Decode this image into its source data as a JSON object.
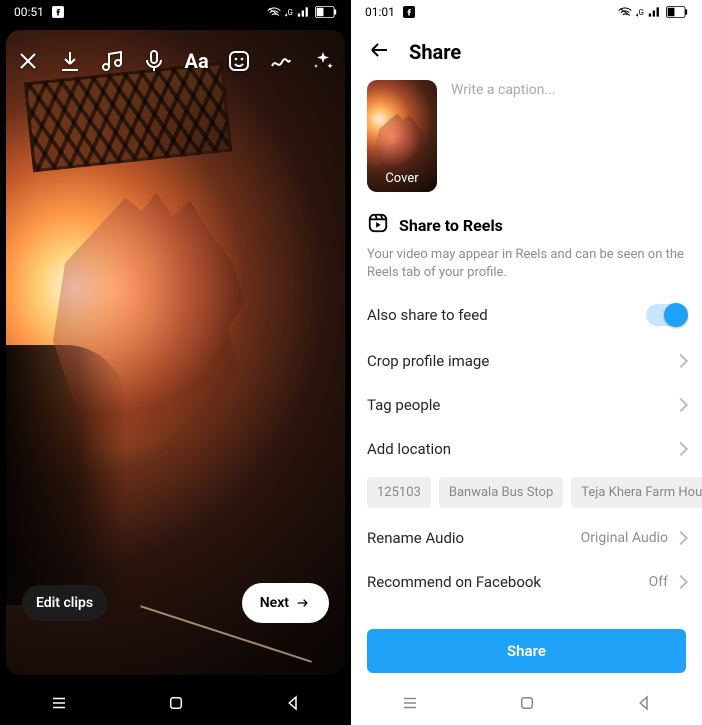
{
  "editor": {
    "status": {
      "time": "00:51"
    },
    "toolbar": {
      "close": "close-icon",
      "download": "download-icon",
      "music": "music-icon",
      "mic": "mic-icon",
      "text_label": "Aa",
      "sticker": "sticker-icon",
      "draw": "draw-icon",
      "effects": "sparkle-icon"
    },
    "bottom": {
      "edit_clips": "Edit clips",
      "next": "Next"
    }
  },
  "share": {
    "status": {
      "time": "01:01"
    },
    "header": {
      "title": "Share"
    },
    "caption_placeholder": "Write a caption...",
    "cover_label": "Cover",
    "section_title": "Share to Reels",
    "section_subtitle": "Your video may appear in Reels and can be seen on the Reels tab of your profile.",
    "rows": {
      "also_share_feed": "Also share to feed",
      "crop_profile": "Crop profile image",
      "tag_people": "Tag people",
      "add_location": "Add location",
      "rename_audio": "Rename Audio",
      "rename_audio_value": "Original Audio",
      "recommend_fb": "Recommend on Facebook",
      "recommend_fb_value": "Off"
    },
    "chips": [
      "125103",
      "Banwala Bus Stop",
      "Teja Khera Farm House"
    ],
    "share_button": "Share",
    "toggle_feed_on": true
  }
}
